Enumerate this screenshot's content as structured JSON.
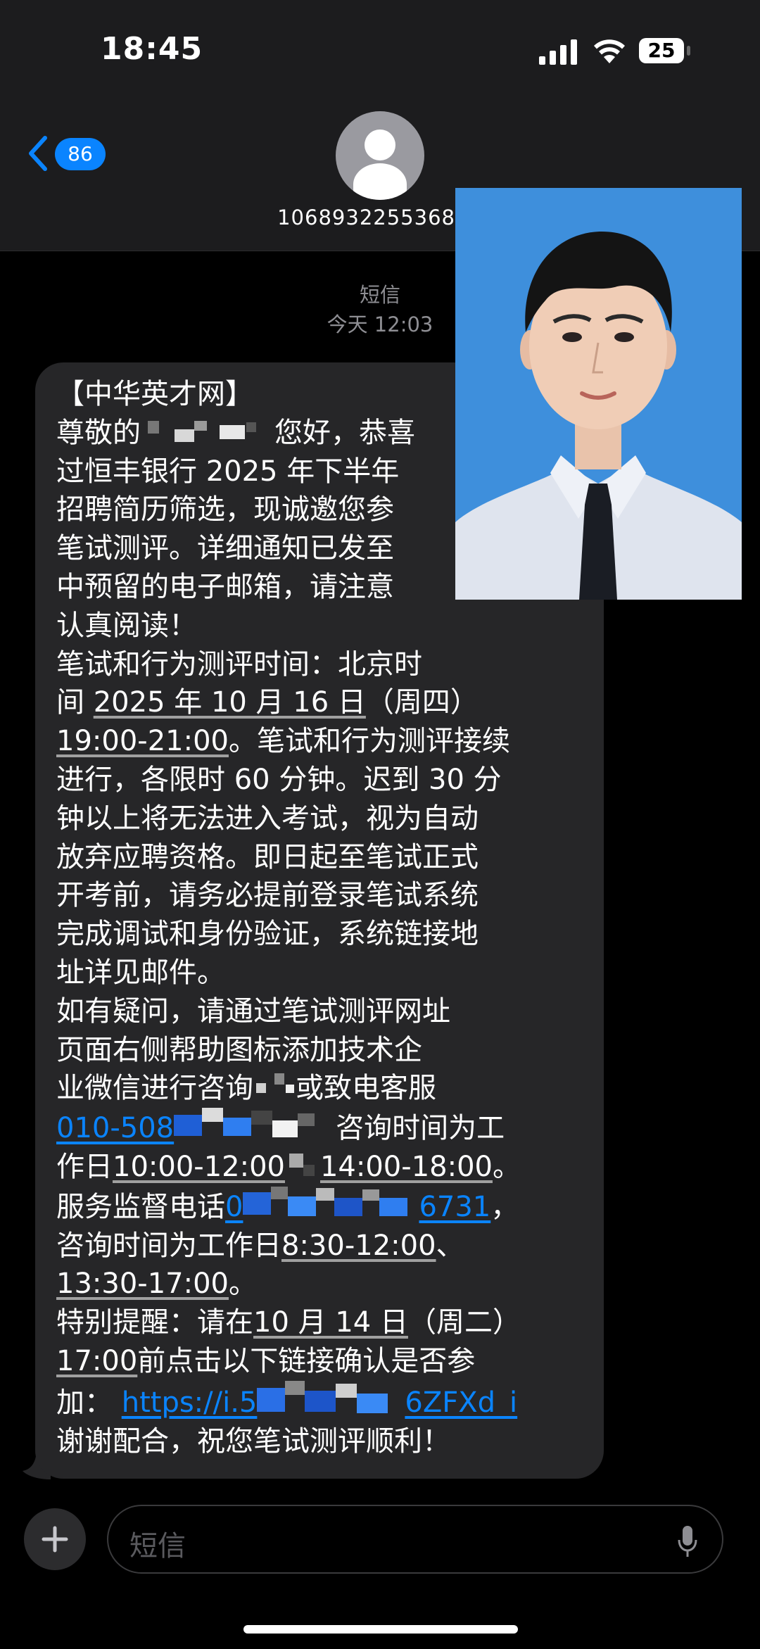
{
  "status_bar": {
    "time": "18:45",
    "battery": "25"
  },
  "header": {
    "back_count": "86",
    "contact_name": "106893225536862"
  },
  "timestamp": {
    "label": "短信",
    "time": "今天 12:03"
  },
  "message": {
    "l1": "【中华英才网】",
    "l2a": "尊敬的",
    "l2b": "您好，恭喜",
    "l3": "过恒丰银行 2025 年下半年",
    "l4": "招聘简历筛选，现诚邀您参",
    "l5": "笔试测评。详细通知已发至",
    "l6": "中预留的电子邮箱，请注意",
    "l7": "认真阅读！",
    "l8": "笔试和行为测评时间：北京时",
    "l9a": "间 ",
    "l9b": "2025 年 10 月 16 日",
    "l9c": "（周四）",
    "l10a": "19:00-21:00",
    "l10b": "。笔试和行为测评接续",
    "l11": "进行，各限时 60 分钟。迟到 30 分",
    "l12": "钟以上将无法进入考试，视为自动",
    "l13": "放弃应聘资格。即日起至笔试正式",
    "l14": "开考前，请务必提前登录笔试系统",
    "l15": "完成调试和身份验证，系统链接地",
    "l16": "址详见邮件。",
    "l17": "如有疑问，请通过笔试测评网址",
    "l18": "页面右侧帮助图标添加技术企",
    "l19a": "业微信进行咨询",
    "l19b": "或致电客服",
    "l20a": "010-508",
    "l20b": "咨询时间为工",
    "l21a": "作日",
    "l21b": "10:00-12:00",
    "l21c": "14:00-18:00",
    "l21d": "。",
    "l22a": "服务监督电话",
    "l22b": "0",
    "l22c": "6731",
    "l22d": "，",
    "l23a": "咨询时间为工作日",
    "l23b": "8:30-12:00",
    "l23c": "、",
    "l24a": "13:30-17:00",
    "l24b": "。",
    "l25a": "特别提醒：请在",
    "l25b": "10 月 14 日",
    "l25c": "（周二）",
    "l26a": "17:00",
    "l26b": "前点击以下链接确认是否参",
    "l27a": "加：",
    "l27b": "https://i.5",
    "l27c": "6ZFXd_i",
    "l28": "谢谢配合，祝您笔试测评顺利！"
  },
  "input": {
    "placeholder": "短信"
  },
  "colors": {
    "accent": "#0a84ff",
    "bubble": "#262628",
    "background": "#000000"
  }
}
